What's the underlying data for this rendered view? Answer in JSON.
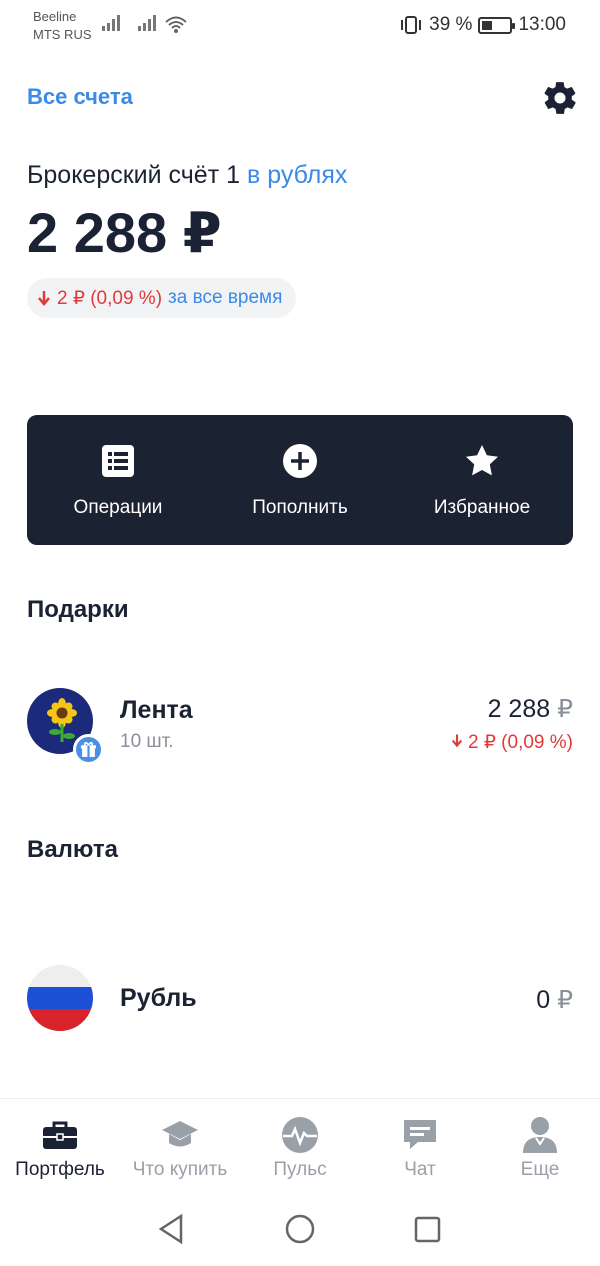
{
  "status_bar": {
    "carrier1": "Beeline",
    "carrier2": "MTS RUS",
    "battery_percent": "39 %",
    "battery_level": 0.39,
    "time": "13:00"
  },
  "header": {
    "all_accounts_label": "Все счета",
    "settings_icon": "gear-icon"
  },
  "account": {
    "title": "Брокерский счёт 1",
    "currency_label": "в рублях",
    "balance": "2 288 ₽",
    "change_value": "2 ₽ (0,09 %)",
    "change_period": "за все время",
    "change_color": "#e03a3a"
  },
  "actions": [
    {
      "label": "Операции",
      "icon": "list-icon"
    },
    {
      "label": "Пополнить",
      "icon": "plus-circle-icon"
    },
    {
      "label": "Избранное",
      "icon": "star-icon"
    }
  ],
  "sections": {
    "gifts_title": "Подарки",
    "currency_title": "Валюта"
  },
  "gift_asset": {
    "name": "Лента",
    "quantity": "10 шт.",
    "value_number": "2 288",
    "value_currency": "₽",
    "change": "2 ₽ (0,09 %)",
    "icon": "sunflower-logo"
  },
  "currency_asset": {
    "name": "Рубль",
    "value_number": "0",
    "value_currency": "₽",
    "icon": "russia-flag"
  },
  "bottom_nav": [
    {
      "label": "Портфель",
      "icon": "briefcase-icon",
      "active": true
    },
    {
      "label": "Что купить",
      "icon": "graduation-cap-icon",
      "active": false
    },
    {
      "label": "Пульс",
      "icon": "pulse-icon",
      "active": false
    },
    {
      "label": "Чат",
      "icon": "chat-icon",
      "active": false
    },
    {
      "label": "Еще",
      "icon": "person-icon",
      "active": false
    }
  ],
  "colors": {
    "accent": "#3b8ae6",
    "dark_panel": "#1b2232",
    "negative": "#e03a3a",
    "muted": "#9aa0a8"
  }
}
